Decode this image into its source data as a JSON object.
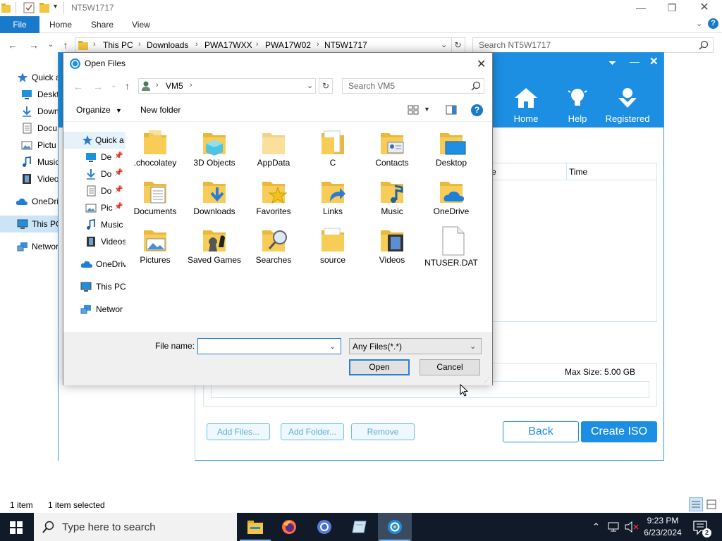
{
  "explorer": {
    "title": "NT5W1717",
    "ribbon_tabs": [
      "File",
      "Home",
      "Share",
      "View"
    ],
    "breadcrumb": [
      "This PC",
      "Downloads",
      "PWA17WXX",
      "PWA17W02",
      "NT5W1717"
    ],
    "search_placeholder": "Search NT5W1717",
    "nav_items": [
      "Quick a",
      "Deskt",
      "Down",
      "Docu",
      "Pictu",
      "Music",
      "Video",
      "OneDri",
      "This PC",
      "Networ"
    ],
    "status_items": "1 item",
    "status_selected": "1 item selected"
  },
  "app": {
    "nav": [
      "Home",
      "Help",
      "Registered"
    ],
    "columns": [
      "e",
      "Time"
    ],
    "max_size": "Max Size: 5.00 GB",
    "buttons": {
      "add_files": "Add Files...",
      "add_folder": "Add Folder...",
      "remove": "Remove",
      "back": "Back",
      "create_iso": "Create ISO"
    },
    "colors": {
      "header": "#1d8fe3",
      "accent": "#1d8fe3"
    }
  },
  "dialog": {
    "title": "Open Files",
    "path": "VM5",
    "search_placeholder": "Search VM5",
    "toolbar": {
      "organize": "Organize",
      "new_folder": "New folder"
    },
    "nav_items": [
      "Quick a",
      "De",
      "Do",
      "Do",
      "Pic",
      "Music",
      "Videos",
      "OneDriv",
      "This PC",
      "Networ"
    ],
    "items": [
      ".chocolatey",
      "3D Objects",
      "AppData",
      "C",
      "Contacts",
      "Desktop",
      "Documents",
      "Downloads",
      "Favorites",
      "Links",
      "Music",
      "OneDrive",
      "Pictures",
      "Saved Games",
      "Searches",
      "source",
      "Videos",
      "NTUSER.DAT"
    ],
    "file_name_label": "File name:",
    "file_name_value": "",
    "file_type": "Any Files(*.*)",
    "open_label": "Open",
    "cancel_label": "Cancel"
  },
  "taskbar": {
    "search_placeholder": "Type here to search",
    "time": "9:23 PM",
    "date": "6/23/2024",
    "notification_count": "2"
  }
}
